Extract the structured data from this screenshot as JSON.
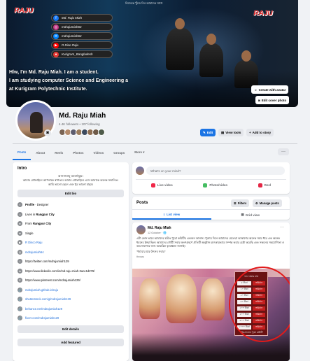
{
  "cover": {
    "top_tagline": "নিজেকে খুঁজে নিন আমাদের সাথে",
    "logo_left": "RAJU",
    "logo_right": "RAJU",
    "social": [
      {
        "icon": "facebook-icon",
        "label": "Md. Raju Miah",
        "color": "#1877f2",
        "glyph": "f"
      },
      {
        "icon": "instagram-icon",
        "label": "mdrajumiah64",
        "color": "#c13584",
        "glyph": "◎"
      },
      {
        "icon": "messenger-icon",
        "label": "mdrajumiah64",
        "color": "#0084ff",
        "glyph": "✉"
      },
      {
        "icon": "youtube-icon",
        "label": "R Diso Raju",
        "color": "#ff0000",
        "glyph": "▶"
      },
      {
        "icon": "location-pin-icon",
        "label": "Kurigram_Bangladesh",
        "color": "#e53935",
        "glyph": "●"
      }
    ],
    "tagline_1": "Hlw, I'm Md. Raju Miah. I am a student.",
    "tagline_2": "I am studying computer Science and Engineering a",
    "tagline_3": "at Kurigram Polytechnic Institute.",
    "create_avatar": "Create with avatar",
    "edit_cover": "Edit cover photo"
  },
  "profile": {
    "name": "Md. Raju Miah",
    "stats": "4.4K followers • 107 following",
    "edit": "Edit",
    "view_tools": "View tools",
    "add_story": "Add to story"
  },
  "nav": {
    "tabs": [
      "Posts",
      "About",
      "Reels",
      "Photos",
      "Videos",
      "Groups",
      "More ▾"
    ],
    "more": "···"
  },
  "intro": {
    "title": "Intro",
    "bio_1": "আসসালামু আলাইকুম।",
    "bio_2": "আমার প্রোফাইলে আপনাকে স্বাগতম। আমার প্রোফাইলে এসে আমাকে অনেক সম্মানিত।",
    "bio_3": "আমি ভালো ছেলে এবং খুব ভালো মানুষ।",
    "edit_bio": "Edit bio",
    "items": [
      {
        "icon": "briefcase-icon",
        "glyph": "▪",
        "pre": "",
        "bold": "Profile",
        "post": " · Designer",
        "link": false
      },
      {
        "icon": "home-icon",
        "glyph": "⌂",
        "pre": "Lives in ",
        "bold": "Rangpur City",
        "post": "",
        "link": false
      },
      {
        "icon": "location-pin-icon",
        "glyph": "●",
        "pre": "From ",
        "bold": "Rangpur City",
        "post": "",
        "link": false
      },
      {
        "icon": "heart-icon",
        "glyph": "♥",
        "pre": "Single",
        "bold": "",
        "post": "",
        "link": false
      },
      {
        "icon": "youtube-icon",
        "glyph": "▶",
        "pre": "R Disco Raju",
        "bold": "",
        "post": "",
        "link": true
      },
      {
        "icon": "instagram-icon",
        "glyph": "◎",
        "pre": "mdrajumiah64",
        "bold": "",
        "post": "",
        "link": true
      },
      {
        "icon": "twitter-icon",
        "glyph": "t",
        "pre": "https://twitter.com/mdrajumiah129",
        "bold": "",
        "post": "",
        "link": false
      },
      {
        "icon": "linkedin-icon",
        "glyph": "in",
        "pre": "https://www.linkedin.com/in/md-raju-miah-3ace1d276/",
        "bold": "",
        "post": "",
        "link": false
      },
      {
        "icon": "pinterest-icon",
        "glyph": "P",
        "pre": "https://www.pinterest.com/mdrajumiah129/",
        "bold": "",
        "post": "",
        "link": false
      },
      {
        "icon": "link-icon",
        "glyph": "🔗",
        "pre": "mdrajumiah.github.io/raju",
        "bold": "",
        "post": "",
        "link": true
      },
      {
        "icon": "link-icon",
        "glyph": "🔗",
        "pre": "shutterstock.com/g/mdrajumiah129",
        "bold": "",
        "post": "",
        "link": true
      },
      {
        "icon": "link-icon",
        "glyph": "🔗",
        "pre": "behance.net/mdrajumiah129",
        "bold": "",
        "post": "",
        "link": true
      },
      {
        "icon": "link-icon",
        "glyph": "🔗",
        "pre": "fiverr.com/mdrajumiah129",
        "bold": "",
        "post": "",
        "link": true
      }
    ],
    "edit_details": "Edit details",
    "add_featured": "Add featured"
  },
  "composer": {
    "placeholder": "What's on your mind?",
    "live": "Live video",
    "photo": "Photo/video",
    "reel": "Reel"
  },
  "posts": {
    "title": "Posts",
    "filters": "Filters",
    "manage": "Manage posts",
    "list_view": "List view",
    "grid_view": "Grid view"
  },
  "post": {
    "author": "Md. Raju Miah",
    "time": "12 October · 🌐",
    "more": "···",
    "text_1": "এটা কোন ভাবে আমাদের চর্চিত পুরো কমিটির একজন জানান। পূজার দিনে আমাদের মেলেরা আকাশের অনেক সময় ধরে এক অনেক ধরনের ইচ্ছা ছিল। আমাদের গোষ্ঠী সবার অংশগ্রহণে প্রতিটি অনুষ্ঠান চমৎকারভাবে সম্পন্ন করার চেষ্টা করেছি এবং সকলের সহযোগিতা ও ভালোবাসার জন্য আন্তরিক কৃতজ্ঞতা জানাই।",
    "text_2": "\"ধর্ম যার যার উৎসব সবার\"",
    "tag": "#copy",
    "board_title": "দান দাতার নাম",
    "board_values": [
      "৫ টাকা",
      "১০ টাকা",
      "২০ টাকা",
      "৫০ টাকা",
      "১০০ টাকা",
      "২০০ টাকা",
      "৫০০ টাকা",
      "১০০০ টাকা"
    ],
    "board_labels": [
      "ভরিমান",
      "ভরিমান",
      "ভরিমান",
      "ভরিমান",
      "ভরিমান",
      "ভরিমান",
      "ভরিমান",
      "ভরিমান"
    ],
    "board_footer": "পরিচালনায় পূজা কমিটি"
  }
}
